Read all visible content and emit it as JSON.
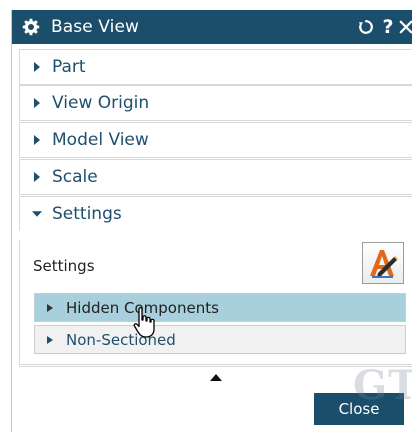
{
  "window": {
    "title": "Base View",
    "icons": [
      "gear-icon",
      "reset-icon",
      "help-icon",
      "close-x-icon"
    ],
    "help_label": "?",
    "titlebar_color": "#1b4e6b"
  },
  "sections": [
    {
      "label": "Part",
      "expanded": false
    },
    {
      "label": "View Origin",
      "expanded": false
    },
    {
      "label": "Model View",
      "expanded": false
    },
    {
      "label": "Scale",
      "expanded": false
    },
    {
      "label": "Settings",
      "expanded": true
    }
  ],
  "settings": {
    "label": "Settings",
    "button_icon": "settings-pen-icon",
    "subsections": [
      {
        "label": "Hidden Components",
        "highlighted": true
      },
      {
        "label": "Non-Sectioned",
        "highlighted": false
      }
    ]
  },
  "footer": {
    "collapse_icon": "collapse-up-icon",
    "close_label": "Close"
  },
  "watermark": {
    "text": "GT"
  },
  "colors": {
    "accent": "#1b4e6b",
    "label_text": "#1e4f6d",
    "highlight_row": "#a7cfdc"
  }
}
